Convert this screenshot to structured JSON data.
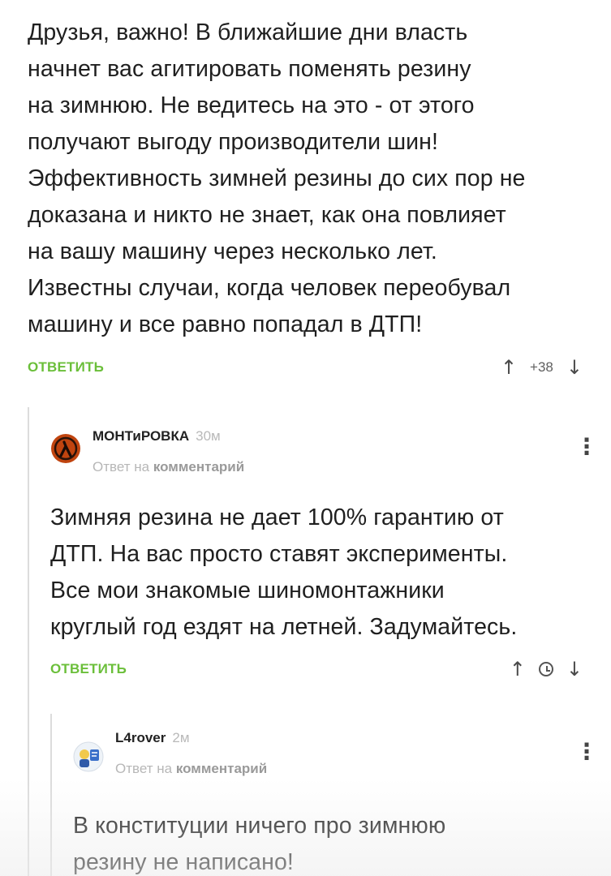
{
  "comment1": {
    "lines": [
      "Друзья, важно! В ближайшие дни власть",
      "начнет вас агитировать поменять резину",
      "на зимнюю. Не ведитесь на это - от этого",
      "получают выгоду производители шин!",
      "Эффективность зимней резины до сих пор не",
      "доказана и никто не знает, как она повлияет",
      "на вашу машину через несколько лет.",
      "Известны случаи, когда человек переобувал",
      "машину и все равно попадал в ДТП!"
    ],
    "reply_label": "ОТВЕТИТЬ",
    "score": "+38",
    "upvote_icon": "↑",
    "downvote_icon": "↓"
  },
  "comment2": {
    "author": "МОНТиРОВКА",
    "time": "30м",
    "reply_to_prefix": "Ответ на",
    "reply_to_link": "комментарий",
    "lines": [
      "Зимняя резина не дает 100% гарантию от",
      "ДТП. На вас просто ставят эксперименты.",
      "Все мои знакомые шиномонтажники",
      "круглый год ездят на летней. Задумайтесь."
    ],
    "reply_label": "ОТВЕТИТЬ",
    "upvote_icon": "↑",
    "downvote_icon": "↓",
    "more_icon": "⋮",
    "avatar_icon": "half-life-lambda-avatar",
    "avatar_color": "#c0440f"
  },
  "comment3": {
    "author": "L4rover",
    "time": "2м",
    "reply_to_prefix": "Ответ на",
    "reply_to_link": "комментарий",
    "lines": [
      "В конституции ничего про зимнюю",
      "резину не написано!"
    ],
    "more_icon": "⋮",
    "avatar_icon": "cartoon-character-avatar"
  },
  "colors": {
    "accent_green": "#6bbf3a",
    "meta_gray": "#b7b7b7",
    "text": "#1f1f1f"
  }
}
